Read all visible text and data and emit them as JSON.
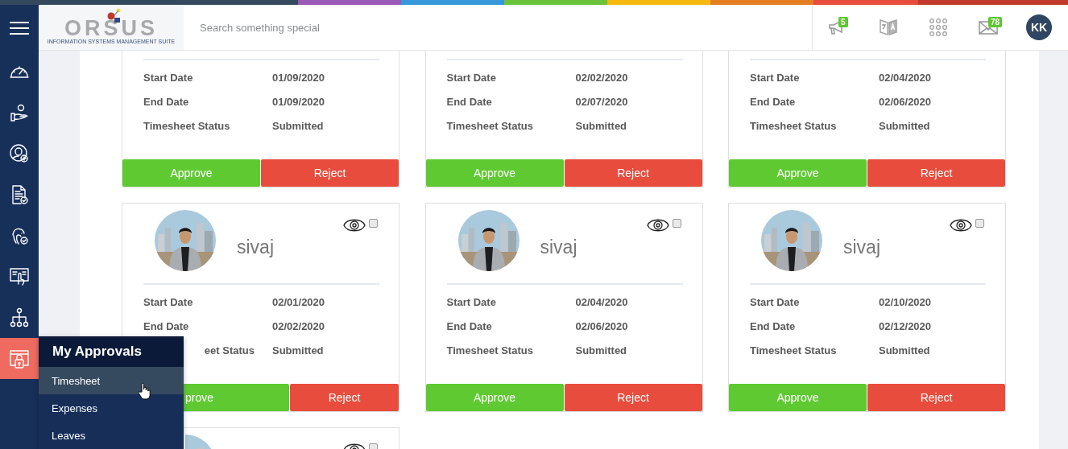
{
  "header": {
    "logo": {
      "name": "ORSUS",
      "tagline": "INFORMATION SYSTEMS MANAGEMENT SUITE"
    },
    "search": {
      "placeholder": "Search something special"
    },
    "notifications": {
      "badge": "5"
    },
    "messages": {
      "badge": "78"
    },
    "user": {
      "initials": "KK"
    }
  },
  "sidebar": {
    "items": [
      {
        "selected": false
      },
      {
        "selected": false
      },
      {
        "selected": false
      },
      {
        "selected": false
      },
      {
        "selected": false
      },
      {
        "selected": false
      },
      {
        "selected": false
      },
      {
        "selected": true
      }
    ]
  },
  "flyout": {
    "title": "My Approvals",
    "items": [
      {
        "label": "Timesheet",
        "selected": true
      },
      {
        "label": "Expenses",
        "selected": false
      },
      {
        "label": "Leaves",
        "selected": false
      }
    ]
  },
  "cards": [
    {
      "fields": [
        {
          "label": "Start Date",
          "value": "01/09/2020"
        },
        {
          "label": "End Date",
          "value": "01/09/2020"
        },
        {
          "label": "Timesheet Status",
          "value": "Submitted"
        }
      ],
      "buttons": [
        {
          "label": "Approve",
          "kind": "approve"
        },
        {
          "label": "Reject",
          "kind": "reject"
        }
      ]
    },
    {
      "fields": [
        {
          "label": "Start Date",
          "value": "02/02/2020"
        },
        {
          "label": "End Date",
          "value": "02/07/2020"
        },
        {
          "label": "Timesheet Status",
          "value": "Submitted"
        }
      ],
      "buttons": [
        {
          "label": "Approve",
          "kind": "approve"
        },
        {
          "label": "Reject",
          "kind": "reject"
        }
      ]
    },
    {
      "fields": [
        {
          "label": "Start Date",
          "value": "02/04/2020"
        },
        {
          "label": "End Date",
          "value": "02/06/2020"
        },
        {
          "label": "Timesheet Status",
          "value": "Submitted"
        }
      ],
      "buttons": [
        {
          "label": "Approve",
          "kind": "approve"
        },
        {
          "label": "Reject",
          "kind": "reject"
        }
      ]
    },
    {
      "photo": true,
      "name": "sivaj",
      "checked": false,
      "fields": [
        {
          "label": "Start Date",
          "value": "02/01/2020"
        },
        {
          "label": "End Date",
          "value": "02/02/2020"
        },
        {
          "label": "eet Status",
          "value": "Submitted",
          "cut": true
        }
      ],
      "buttons": [
        {
          "label": "prove",
          "kind": "approve",
          "cut": true
        },
        {
          "label": "Reject",
          "kind": "reject"
        }
      ]
    },
    {
      "photo": true,
      "name": "sivaj",
      "checked": false,
      "fields": [
        {
          "label": "Start Date",
          "value": "02/04/2020"
        },
        {
          "label": "End Date",
          "value": "02/06/2020"
        },
        {
          "label": "Timesheet Status",
          "value": "Submitted"
        }
      ],
      "buttons": [
        {
          "label": "Approve",
          "kind": "approve"
        },
        {
          "label": "Reject",
          "kind": "reject"
        }
      ]
    },
    {
      "photo": true,
      "name": "sivaj",
      "checked": false,
      "fields": [
        {
          "label": "Start Date",
          "value": "02/10/2020"
        },
        {
          "label": "End Date",
          "value": "02/12/2020"
        },
        {
          "label": "Timesheet Status",
          "value": "Submitted"
        }
      ],
      "buttons": [
        {
          "label": "Approve",
          "kind": "approve"
        },
        {
          "label": "Reject",
          "kind": "reject"
        }
      ]
    },
    {
      "photo": true,
      "checked": false
    }
  ]
}
